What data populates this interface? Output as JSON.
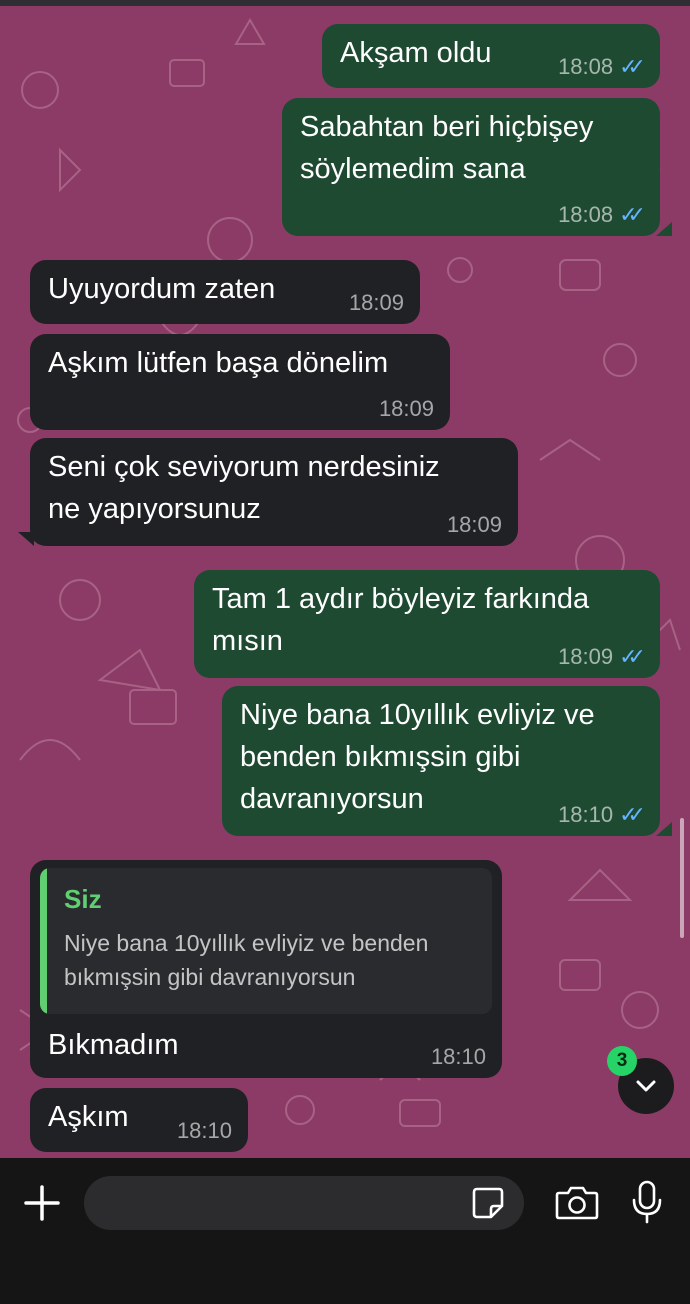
{
  "messages": [
    {
      "text": "Akşam oldu",
      "time": "18:08",
      "direction": "out",
      "ticks": "✓✓"
    },
    {
      "text": "Sabahtan beri hiçbişey\nsöylemedim sana",
      "time": "18:08",
      "direction": "out",
      "ticks": "✓✓"
    },
    {
      "text": "Uyuyordum zaten",
      "time": "18:09",
      "direction": "in"
    },
    {
      "text": "Aşkım lütfen başa dönelim",
      "time": "18:09",
      "direction": "in"
    },
    {
      "text": "Seni çok seviyorum nerdesiniz\nne yapıyorsunuz",
      "time": "18:09",
      "direction": "in"
    },
    {
      "text": "Tam 1 aydır böyleyiz farkında\nmısın",
      "time": "18:09",
      "direction": "out",
      "ticks": "✓✓"
    },
    {
      "text": "Niye bana 10yıllık evliyiz ve\nbenden bıkmışsin gibi\ndavranıyorsun",
      "time": "18:10",
      "direction": "out",
      "ticks": "✓✓"
    },
    {
      "text": "Bıkmadım",
      "time": "18:10",
      "direction": "in",
      "quote": {
        "author": "Siz",
        "text": "Niye bana 10yıllık evliyiz ve benden\nbıkmışsin gibi davranıyorsun"
      }
    },
    {
      "text": "Aşkım",
      "time": "18:10",
      "direction": "in"
    }
  ],
  "scroll_button": {
    "badge": "3",
    "icon": "chevron-down-icon"
  },
  "input_bar": {
    "placeholder": "",
    "icons": [
      "plus-icon",
      "sticker-icon",
      "camera-icon",
      "microphone-icon"
    ]
  },
  "colors": {
    "chat_background": "#8b3b65",
    "outgoing_bubble": "#1f4a32",
    "incoming_bubble": "#202124",
    "read_ticks": "#64b4ff",
    "quote_accent": "#5fcf72",
    "badge": "#25d366"
  }
}
